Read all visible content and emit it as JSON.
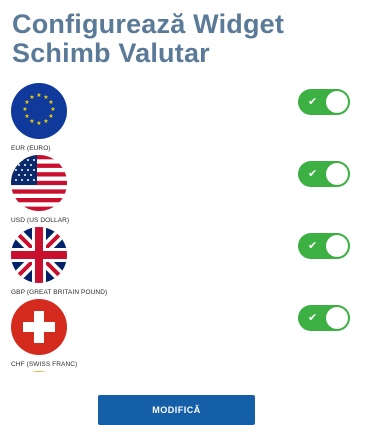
{
  "header": {
    "title": "Configurează Widget Schimb Valutar"
  },
  "currencies": [
    {
      "label": "EUR (EURO)",
      "flag": "eu-flag-icon",
      "enabled": true
    },
    {
      "label": "USD (US DOLLAR)",
      "flag": "us-flag-icon",
      "enabled": true
    },
    {
      "label": "GBP (GREAT BRITAIN POUND)",
      "flag": "uk-flag-icon",
      "enabled": true
    },
    {
      "label": "CHF (SWISS FRANC)",
      "flag": "swiss-flag-icon",
      "enabled": true
    }
  ],
  "toggle": {
    "check_glyph": "✔"
  },
  "footer": {
    "modify_label": "MODIFICĂ"
  },
  "colors": {
    "title": "#5a7a98",
    "toggle_on": "#3cb043",
    "button": "#155fa8"
  }
}
